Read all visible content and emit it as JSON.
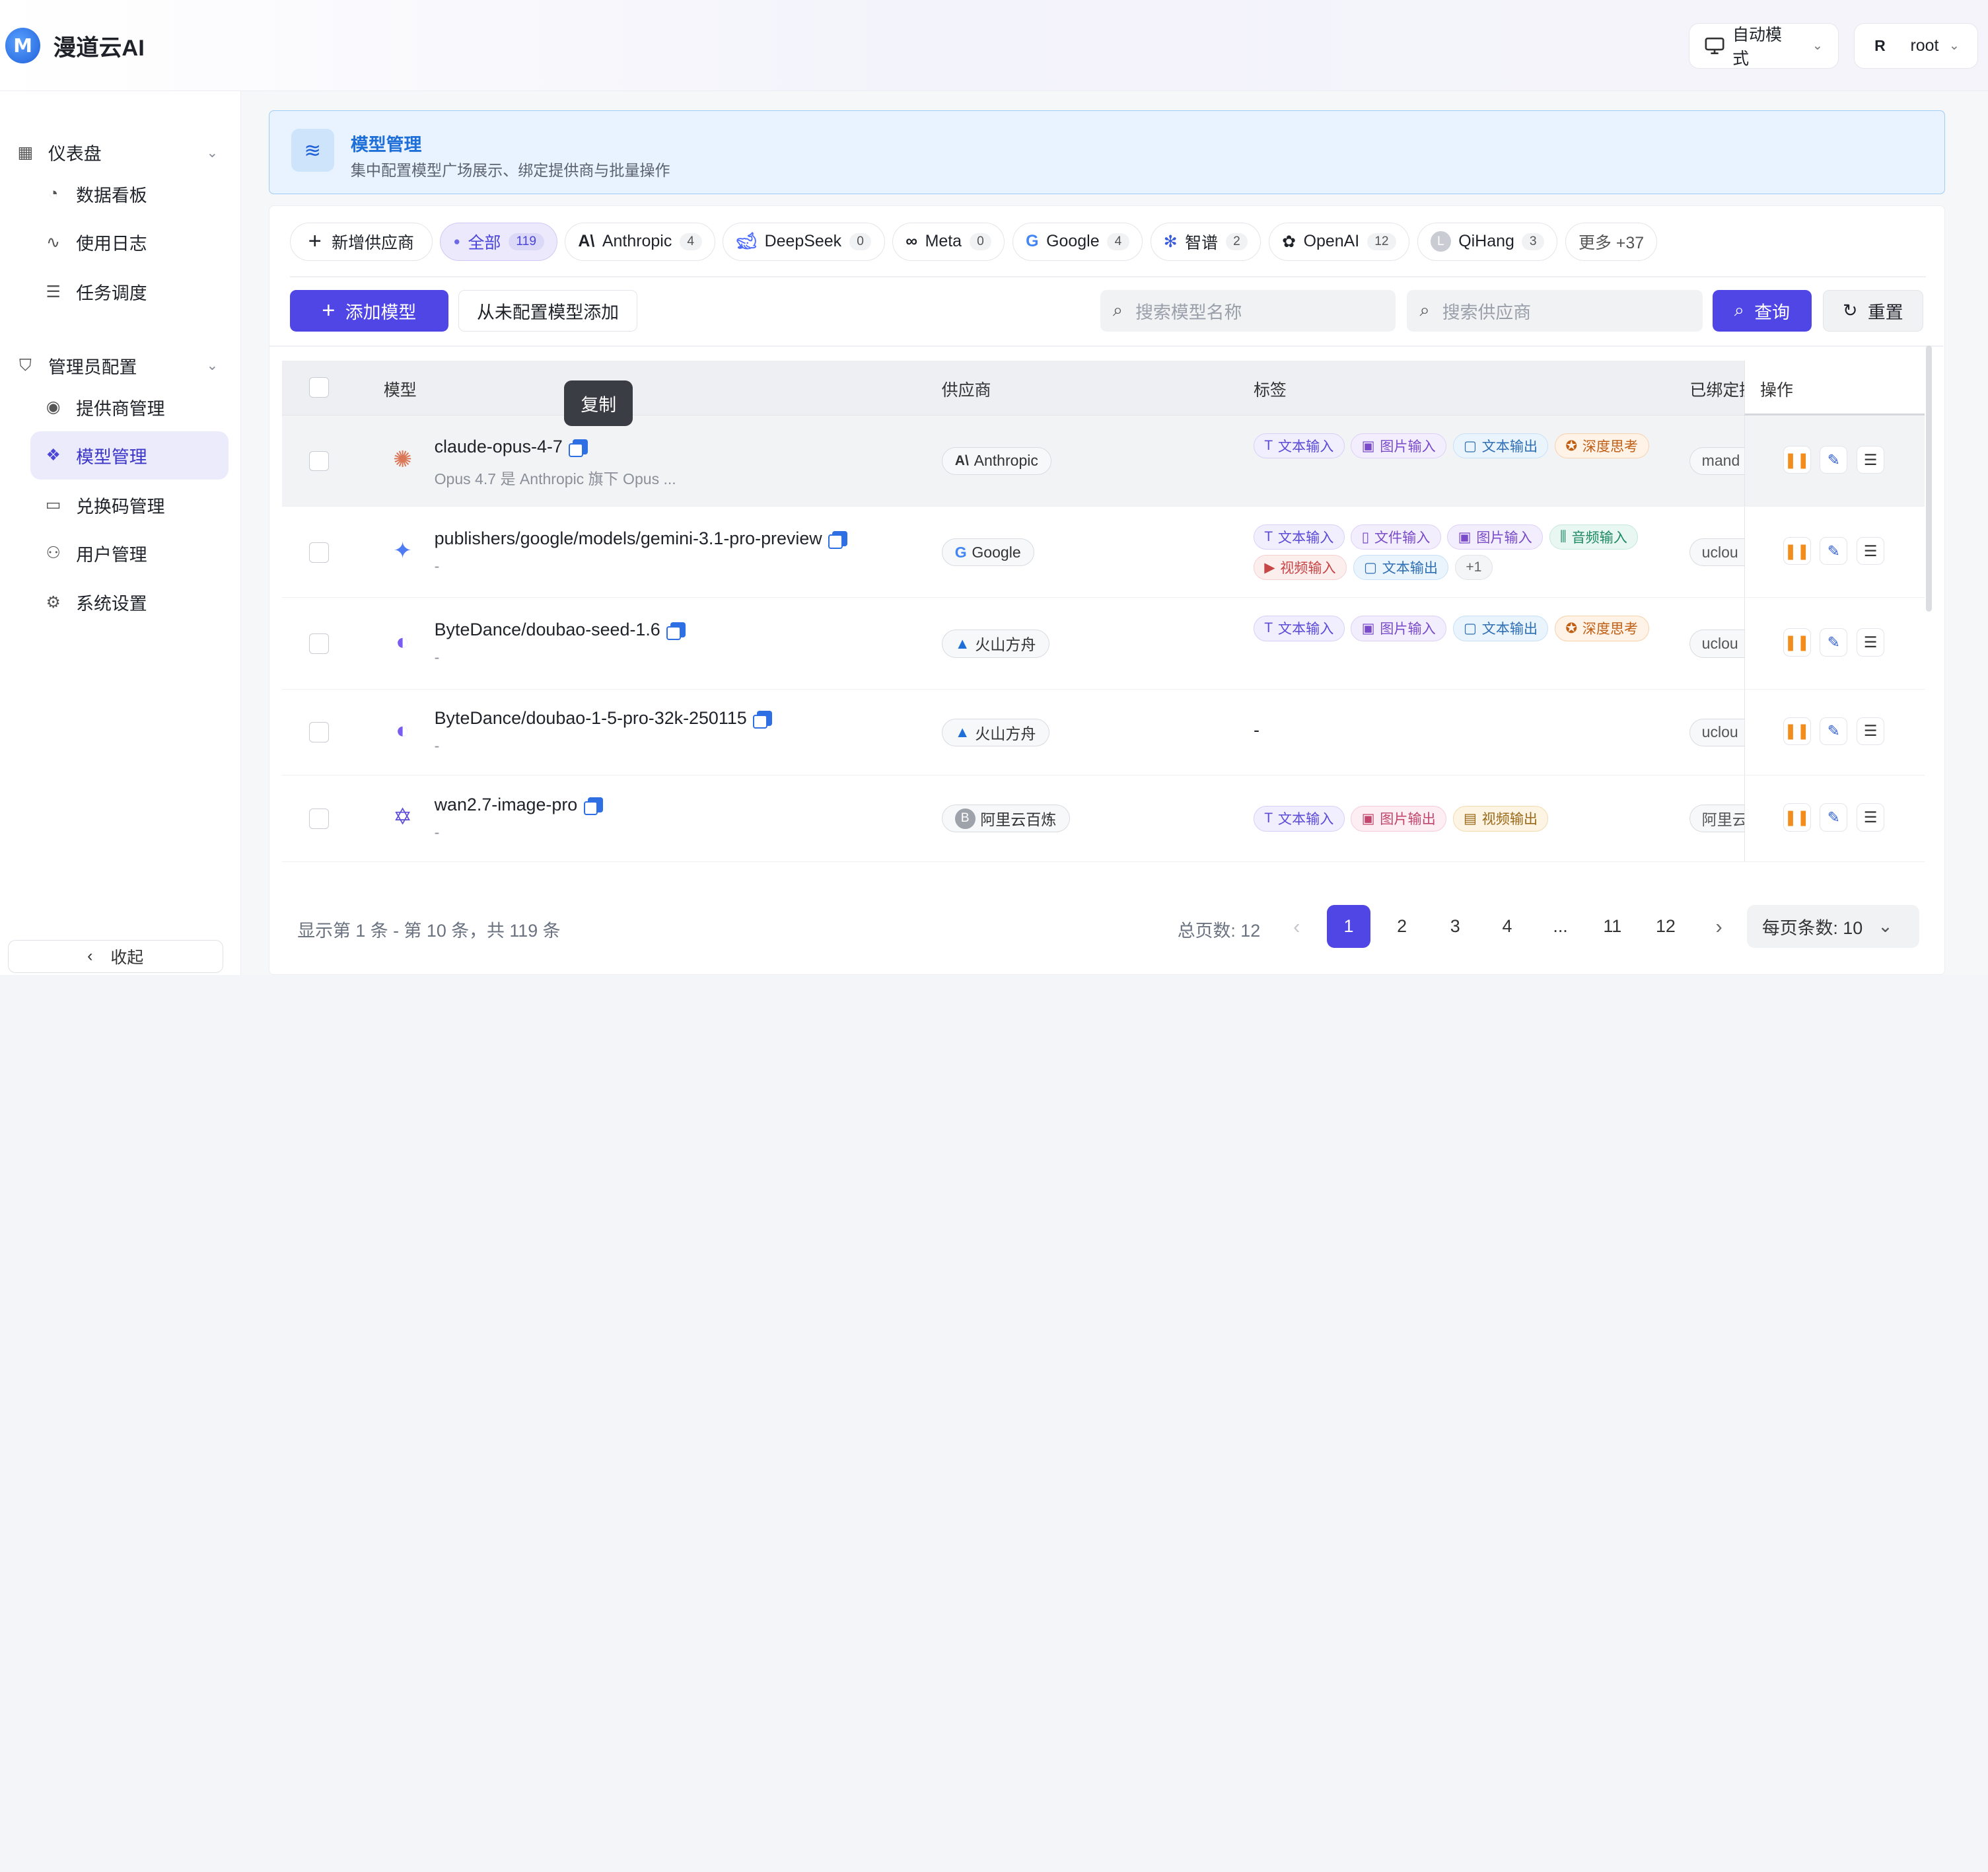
{
  "app": {
    "name": "漫道云AI",
    "logo_letter": "M"
  },
  "header": {
    "mode_label": "自动模式",
    "user_initial": "R",
    "user_name": "root"
  },
  "sidebar": {
    "groups": [
      {
        "label": "仪表盘",
        "items": [
          {
            "label": "数据看板",
            "icon": "gauge-icon"
          },
          {
            "label": "使用日志",
            "icon": "activity-icon"
          },
          {
            "label": "任务调度",
            "icon": "list-check-icon"
          }
        ]
      },
      {
        "label": "管理员配置",
        "items": [
          {
            "label": "提供商管理",
            "icon": "broadcast-icon"
          },
          {
            "label": "模型管理",
            "icon": "cubes-icon"
          },
          {
            "label": "兑换码管理",
            "icon": "ticket-icon"
          },
          {
            "label": "用户管理",
            "icon": "user-gear-icon"
          },
          {
            "label": "系统设置",
            "icon": "gear-icon"
          }
        ]
      }
    ],
    "active_item": "模型管理",
    "collapse_label": "收起"
  },
  "banner": {
    "title": "模型管理",
    "subtitle": "集中配置模型广场展示、绑定提供商与批量操作"
  },
  "providers": {
    "add_label": "新增供应商",
    "chips": [
      {
        "label": "全部",
        "count": "119",
        "active": true
      },
      {
        "label": "Anthropic",
        "count": "4"
      },
      {
        "label": "DeepSeek",
        "count": "0"
      },
      {
        "label": "Meta",
        "count": "0"
      },
      {
        "label": "Google",
        "count": "4"
      },
      {
        "label": "智谱",
        "count": "2"
      },
      {
        "label": "OpenAI",
        "count": "12"
      },
      {
        "label": "QiHang",
        "count": "3"
      }
    ],
    "more_label": "更多 +37"
  },
  "toolbar": {
    "add_model": "添加模型",
    "add_unconfigured": "从未配置模型添加",
    "search_model_placeholder": "搜索模型名称",
    "search_vendor_placeholder": "搜索供应商",
    "query": "查询",
    "reset": "重置"
  },
  "table": {
    "headers": {
      "model": "模型",
      "vendor": "供应商",
      "tags": "标签",
      "bound": "已绑定提",
      "ops": "操作"
    },
    "tooltip": "复制",
    "rows": [
      {
        "name": "claude-opus-4-7",
        "desc": "Opus 4.7 是 Anthropic 旗下 Opus ...",
        "vendor": "Anthropic",
        "tags": [
          [
            "文本输入",
            "purple"
          ],
          [
            "图片输入",
            "violet"
          ],
          [
            "文本输出",
            "blue"
          ],
          [
            "深度思考",
            "orange"
          ]
        ],
        "bound": "mand"
      },
      {
        "name": "publishers/google/models/gemini-3.1-pro-preview",
        "desc": "-",
        "vendor": "Google",
        "tags": [
          [
            "文本输入",
            "purple"
          ],
          [
            "文件输入",
            "violet"
          ],
          [
            "图片输入",
            "violet"
          ],
          [
            "音频输入",
            "green"
          ],
          [
            "视频输入",
            "red"
          ],
          [
            "文本输出",
            "blue"
          ],
          [
            "+1",
            "more"
          ]
        ],
        "bound": "uclou"
      },
      {
        "name": "ByteDance/doubao-seed-1.6",
        "desc": "-",
        "vendor": "火山方舟",
        "tags": [
          [
            "文本输入",
            "purple"
          ],
          [
            "图片输入",
            "violet"
          ],
          [
            "文本输出",
            "blue"
          ],
          [
            "深度思考",
            "orange"
          ]
        ],
        "bound": "uclou"
      },
      {
        "name": "ByteDance/doubao-1-5-pro-32k-250115",
        "desc": "-",
        "vendor": "火山方舟",
        "tags_text": "-",
        "bound": "uclou"
      },
      {
        "name": "wan2.7-image-pro",
        "desc": "-",
        "vendor": "阿里云百炼",
        "tags": [
          [
            "文本输入",
            "purple"
          ],
          [
            "图片输出",
            "pink"
          ],
          [
            "视频输出",
            "gold"
          ]
        ],
        "bound": "阿里云"
      }
    ]
  },
  "pagination": {
    "info": "显示第 1 条 - 第 10 条，共 119 条",
    "total_pages": "总页数: 12",
    "pages": [
      "1",
      "2",
      "3",
      "4",
      "...",
      "11",
      "12"
    ],
    "current": "1",
    "per_page_label": "每页条数: 10"
  },
  "colors": {
    "primary": "#4f46e5",
    "accent_blue": "#2f6fe4",
    "pause_orange": "#f28c1b"
  }
}
